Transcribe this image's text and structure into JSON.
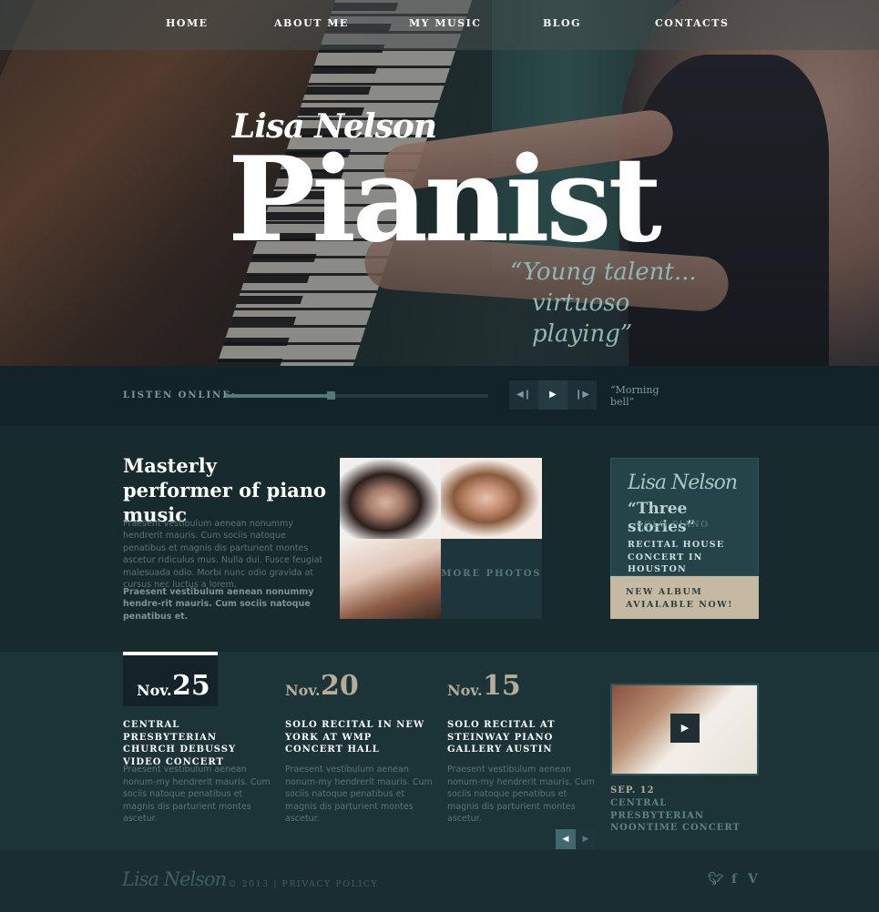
{
  "nav": {
    "items": [
      "HOME",
      "ABOUT ME",
      "MY MUSIC",
      "BLOG",
      "CONTACTS"
    ]
  },
  "hero": {
    "script_name": "Lisa Nelson",
    "title": "Pianist",
    "quote_line1": "“Young talent...",
    "quote_line2": "virtuoso playing”"
  },
  "player": {
    "label": "LISTEN ONLINE:",
    "progress": 0.4,
    "now_playing": "“Morning bell”",
    "prev_icon": "skip-back-icon",
    "play_icon": "play-icon",
    "next_icon": "skip-forward-icon"
  },
  "intro": {
    "title": "Masterly performer of piano music",
    "p1": "Praesent vestibulum aenean nonummy hendrerit mauris. Cum sociis natoque penatibus et magnis dis parturient montes ascetur ridiculus mus. Nulla dui. Fusce feugiat malesuada odio. Morbi nunc odio gravida at cursus nec luctus a lorem.",
    "p2": "Praesent vestibulum aenean nonummy hendre-rit mauris. Cum sociis natoque penatibus et."
  },
  "photos": {
    "more_label": "MORE PHOTOS"
  },
  "album": {
    "script_name": "Lisa Nelson",
    "name": "“Three stories”",
    "sub": "SOLO PIANO",
    "recital": "RECITAL HOUSE CONCERT IN HOUSTON",
    "cta": "NEW ALBUM AVIALABLE NOW!"
  },
  "events": [
    {
      "month": "Nov.",
      "day": "25",
      "title": "CENTRAL PRESBYTERIAN CHURCH DEBUSSY VIDEO CONCERT",
      "text": "Praesent vestibulum aenean nonum-my hendrerit mauris. Cum sociis natoque penatibus et magnis dis parturient montes ascetur."
    },
    {
      "month": "Nov.",
      "day": "20",
      "title": "SOLO RECITAL IN NEW YORK AT WMP CONCERT HALL",
      "text": "Praesent vestibulum aenean nonum-my hendrerit mauris. Cum sociis natoque penatibus et magnis dis parturient montes ascetur."
    },
    {
      "month": "Nov.",
      "day": "15",
      "title": "SOLO RECITAL AT STEINWAY PIANO GALLERY AUSTIN",
      "text": "Praesent vestibulum aenean nonum-my hendrerit mauris. Cum sociis natoque penatibus et magnis dis parturient montes ascetur."
    }
  ],
  "video": {
    "date": "SEP. 12",
    "title": "CENTRAL PRESBYTERIAN NOONTIME CONCERT",
    "play_icon": "play-icon"
  },
  "pager": {
    "prev_icon": "chevron-left-icon",
    "next_icon": "chevron-right-icon"
  },
  "footer": {
    "logo": "Lisa Nelson",
    "copyright": "© 2013 | PRIVACY POLICY",
    "social": [
      "twitter-icon",
      "facebook-icon",
      "vimeo-icon"
    ]
  },
  "colors": {
    "accent_teal": "#8fb7b5",
    "album_beige": "#c5b9a2",
    "background": "#172a2e"
  }
}
